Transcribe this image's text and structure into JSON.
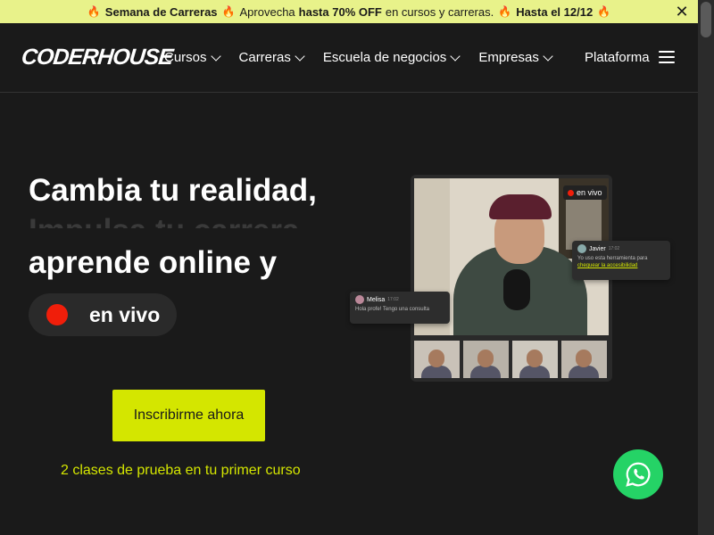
{
  "promo": {
    "part1": "Semana de Carreras",
    "part2": "Aprovecha",
    "part3": "hasta 70% OFF",
    "part4": "en cursos y carreras.",
    "part5": "Hasta el 12/12",
    "close": "✕"
  },
  "header": {
    "logo": "CODERHOUSE",
    "nav": [
      {
        "label": "Cursos"
      },
      {
        "label": "Carreras"
      },
      {
        "label": "Escuela de negocios"
      },
      {
        "label": "Empresas"
      }
    ],
    "platform": "Plataforma"
  },
  "hero": {
    "line1": "Cambia tu realidad,",
    "line_faded": "Impulsa tu carrera",
    "line2": "aprende online y",
    "live": "en vivo",
    "cta": "Inscribirme ahora",
    "trial": "2 clases de prueba en tu primer curso"
  },
  "video": {
    "live_badge": "en vivo",
    "chat_javier": {
      "name": "Javier",
      "time": "17:02",
      "msg": "Yo uso esta herramienta para",
      "link": "chequear la accesibilidad"
    },
    "chat_melisa": {
      "name": "Melisa",
      "time": "17:02",
      "msg": "Hola profe! Tengo una consulta"
    }
  },
  "icons": {
    "fire": "🔥",
    "whatsapp": "whatsapp-icon",
    "menu": "hamburger-icon"
  },
  "colors": {
    "accent": "#d4e600",
    "promo_bg": "#e8f28a",
    "live_red": "#f01e0a",
    "whatsapp": "#25d366",
    "bg": "#1a1a1a"
  }
}
